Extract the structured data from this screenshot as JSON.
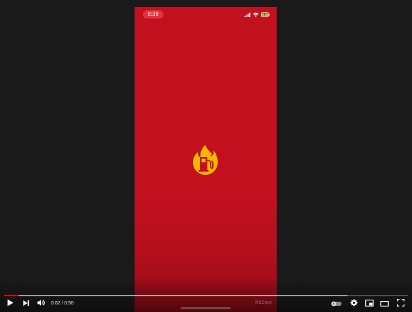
{
  "phone": {
    "status_time": "8:39",
    "watermark": "REC⊙⊙",
    "splash_logo": "flame-fuel-pump-logo",
    "background_color": "#c2101f",
    "logo_color": "#f5b800"
  },
  "player": {
    "current_time": "0:02",
    "separator": " / ",
    "duration": "0:56",
    "progress_fraction": 0.036,
    "loaded_fraction": 0.85,
    "accent_color": "#ff0000",
    "icons": {
      "play": "play-icon",
      "next": "next-icon",
      "volume": "volume-icon",
      "autoplay": "autoplay-toggle-icon",
      "settings": "gear-icon",
      "miniplayer": "miniplayer-icon",
      "theater": "theater-mode-icon",
      "fullscreen": "fullscreen-icon"
    }
  }
}
